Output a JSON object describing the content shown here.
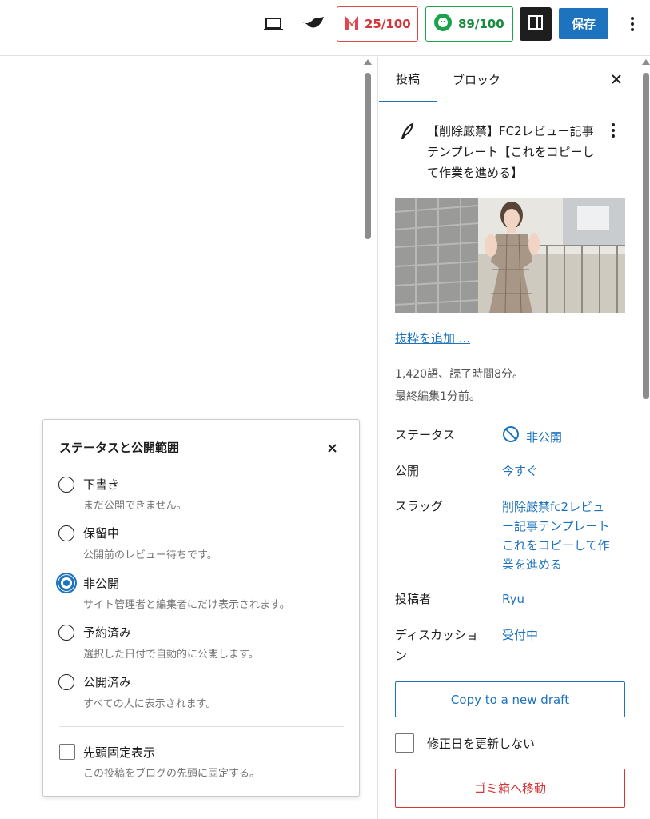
{
  "topbar": {
    "preview_icon": "laptop-icon",
    "brand_icon": "leaf-logo-icon",
    "score1": {
      "value": "25/100",
      "icon": "m-logo-icon",
      "color": "#d63638"
    },
    "score2": {
      "value": "89/100",
      "icon": "gear-face-icon",
      "color": "#1a8a3e"
    },
    "sidebar_toggle_icon": "sidebar-panel-icon",
    "save_label": "保存",
    "more_icon": "vertical-ellipsis-icon"
  },
  "panel": {
    "tabs": [
      {
        "label": "投稿"
      },
      {
        "label": "ブロック"
      }
    ],
    "close_icon": "close-icon",
    "post_title": "【削除厳禁】FC2レビュー記事テンプレート【これをコピーして作業を進める】",
    "excerpt_link": "抜粋を追加 ...",
    "word_count": "1,420語、読了時間8分。",
    "last_edited": "最終編集1分前。",
    "rows": {
      "status": {
        "label": "ステータス",
        "value": "非公開"
      },
      "publish": {
        "label": "公開",
        "value": "今すぐ"
      },
      "slug": {
        "label": "スラッグ",
        "value": "削除厳禁fc2レビュー記事テンプレートこれをコピーして作業を進める"
      },
      "author": {
        "label": "投稿者",
        "value": "Ryu"
      },
      "discussion": {
        "label": "ディスカッション",
        "value": "受付中"
      }
    },
    "copy_button": "Copy to a new draft",
    "no_update_date": "修正日を更新しない",
    "trash_button": "ゴミ箱へ移動"
  },
  "popover": {
    "title": "ステータスと公開範囲",
    "options": [
      {
        "label": "下書き",
        "desc": "まだ公開できません。",
        "selected": false
      },
      {
        "label": "保留中",
        "desc": "公開前のレビュー待ちです。",
        "selected": false
      },
      {
        "label": "非公開",
        "desc": "サイト管理者と編集者にだけ表示されます。",
        "selected": true
      },
      {
        "label": "予約済み",
        "desc": "選択した日付で自動的に公開します。",
        "selected": false
      },
      {
        "label": "公開済み",
        "desc": "すべての人に表示されます。",
        "selected": false
      }
    ],
    "sticky": {
      "label": "先頭固定表示",
      "desc": "この投稿をブログの先頭に固定する。"
    }
  }
}
